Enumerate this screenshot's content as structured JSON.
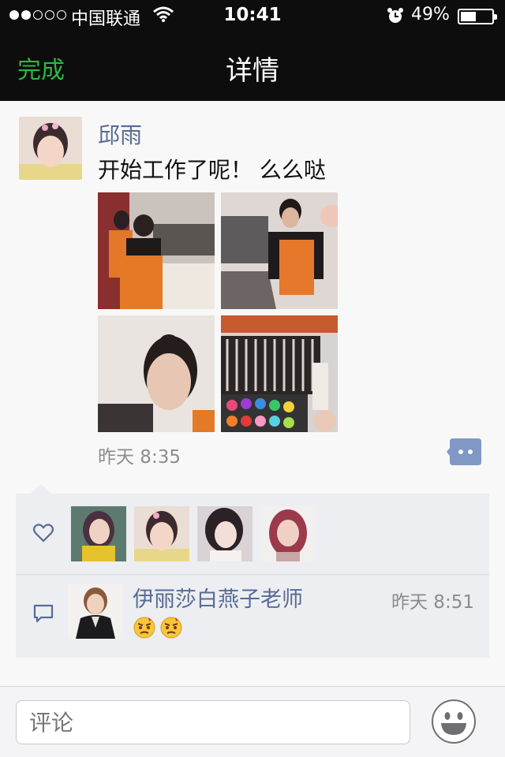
{
  "status_bar": {
    "carrier": "中国联通",
    "time": "10:41",
    "battery": "49%",
    "battery_level": 0.49,
    "signal_bars": 2
  },
  "nav": {
    "done_label": "完成",
    "title": "详情"
  },
  "post": {
    "author": "邱雨",
    "text": "开始工作了呢！ 么么哒",
    "time": "昨天 8:35",
    "photos": [
      "makeup-class-photo",
      "makeup-table-photo",
      "selfie-photo",
      "brushes-palette-photo"
    ]
  },
  "likes": {
    "avatars": [
      "liker-avatar-1",
      "liker-avatar-2",
      "liker-avatar-3",
      "liker-avatar-4"
    ]
  },
  "comment": {
    "author": "伊丽莎白燕子老师",
    "time": "昨天 8:51",
    "emojis": [
      "angry-emoji",
      "angry-emoji"
    ]
  },
  "input": {
    "placeholder": "评论"
  },
  "colors": {
    "accent_green": "#2db83d",
    "name_blue": "#576b95",
    "nav_bg": "#0d0d0d"
  }
}
